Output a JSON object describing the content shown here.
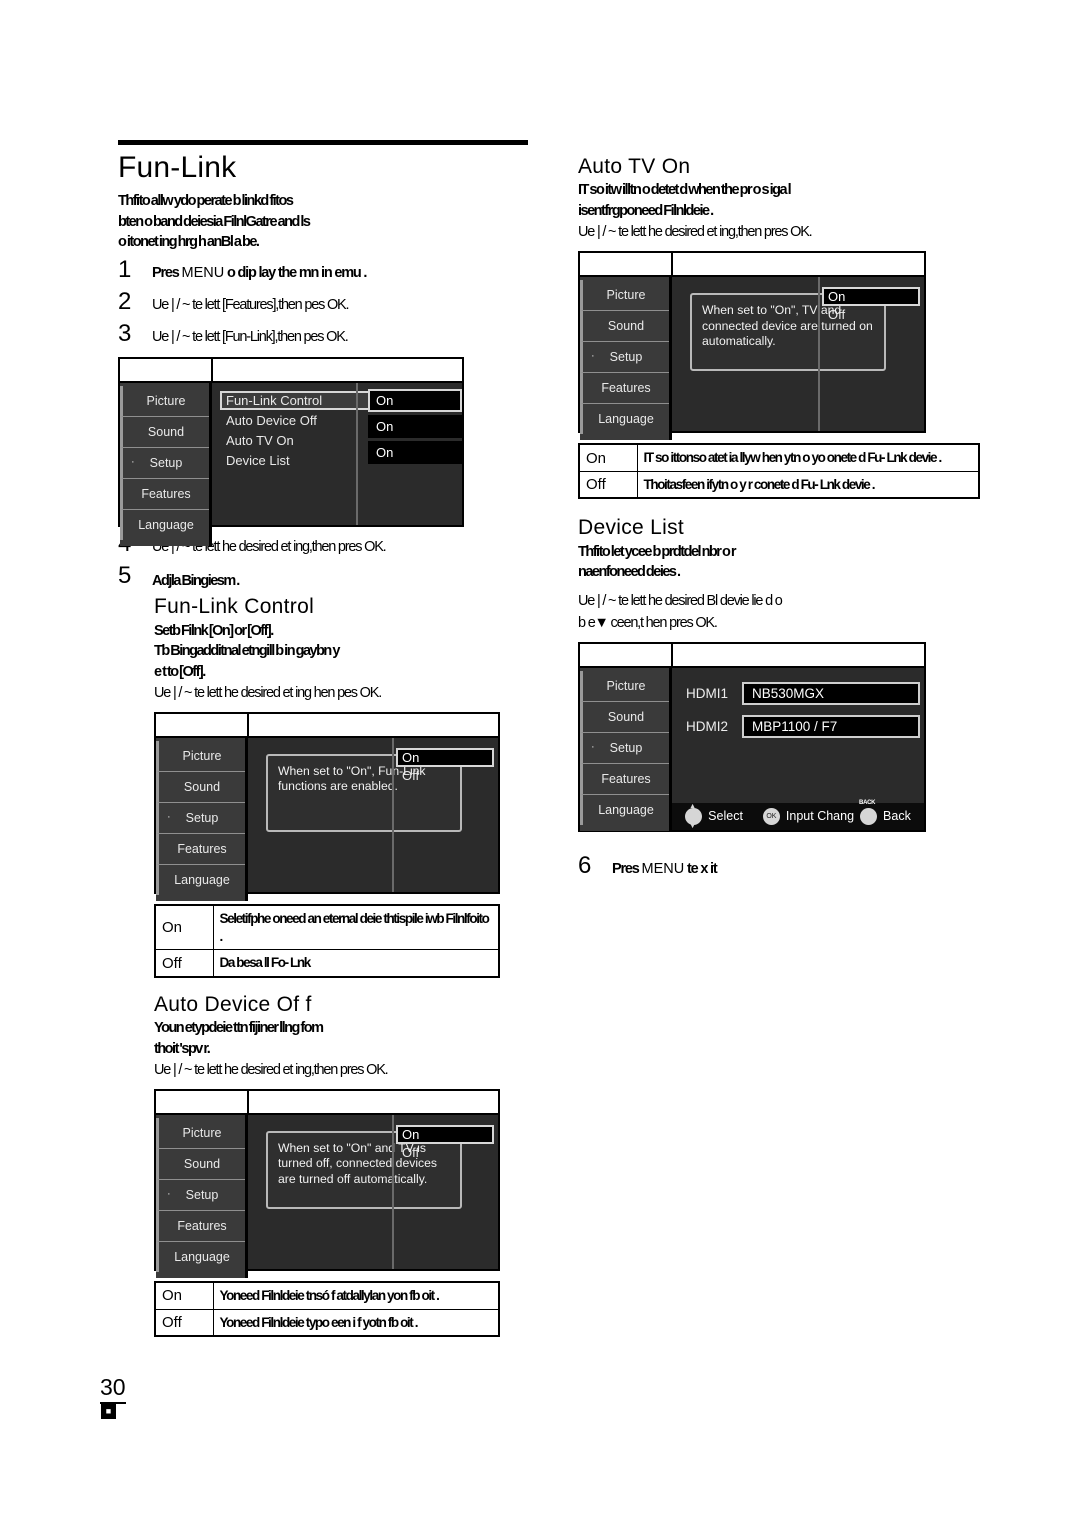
{
  "page": {
    "number": "30",
    "footer_icon": "en-lang-icon"
  },
  "left_column": {
    "title": "Fun-Link",
    "intro_lines": [
      "Thfito allw          ydo       perate b linkd fitos",
      "bten o band deiesia FilnlGatre and ls",
      "o itonet   ing hrg  h anBl       a be."
    ],
    "steps": [
      {
        "num": "1",
        "text_pre": "Pres ",
        "text_mid": "MENU",
        "text_post": " o dip lay the mn in emu ."
      },
      {
        "num": "2",
        "text": "Ue  | / ~  te   lett [Features],then pes  OK."
      },
      {
        "num": "3",
        "text": "Ue  | / ~  te   lett [Fun-Link],then pes  OK."
      },
      {
        "num": "4",
        "text": "Ue  | / ~  te   lett he desired et ing,then pres OK."
      },
      {
        "num": "5",
        "text": "Adjla Bingiesm                 ."
      }
    ],
    "menu_main": {
      "nav": [
        "Picture",
        "Sound",
        "Setup",
        "Features",
        "Language"
      ],
      "selected_nav": "Setup",
      "rows": [
        {
          "label": "Fun-Link Control",
          "value": "On",
          "selected": true
        },
        {
          "label": "Auto Device Off",
          "value": "On",
          "selected": false
        },
        {
          "label": "Auto TV On",
          "value": "On",
          "selected": false
        },
        {
          "label": "Device List",
          "value": "",
          "selected": false
        }
      ]
    },
    "fun_link_control": {
      "heading": "Fun-Link Control",
      "lines": [
        "Setb Filnk          [On] or [Off].",
        "Tb Bingadditnal etngill b in gaybn y",
        "e t to [Off].",
        "Ue  | / ~  te   lett he desired et ing hen pes  OK."
      ],
      "menu": {
        "nav": [
          "Picture",
          "Sound",
          "Setup",
          "Features",
          "Language"
        ],
        "selected_nav": "Setup",
        "help_text": "When set to \"On\", Fun-Link functions are enabled.",
        "options": [
          "On",
          "Off"
        ],
        "selected_option": "On"
      },
      "table": [
        {
          "key": "On",
          "value": "Seletifphe oneed an eternal deie\nthtispile iwb Filnlfoito                      ."
        },
        {
          "key": "Off",
          "value": "Da besa ll Fo- Lnk"
        }
      ]
    },
    "auto_device_off": {
      "heading": "Auto Device Of f",
      "lines": [
        "Youn etypdeie ttn fijiner llng fom",
        "thoit 'spv      r.",
        "Ue  | / ~  te   lett he desired et ing,then pres OK."
      ],
      "menu": {
        "nav": [
          "Picture",
          "Sound",
          "Setup",
          "Features",
          "Language"
        ],
        "selected_nav": "Setup",
        "help_text": "When set to \"On\" and TV is turned off, connected devices are turned off automatically.",
        "options": [
          "On",
          "Off"
        ],
        "selected_option": "On"
      },
      "table": [
        {
          "key": "On",
          "value": "Yoneed Filnldeie tnsó                    f\n atdallylan yon fb oit                        ."
        },
        {
          "key": "Off",
          "value": "Yoneed           Filnldeie      typo een i     f\n yotn fb oit            ."
        }
      ]
    }
  },
  "right_column": {
    "auto_tv_on": {
      "heading": "Auto TV On",
      "lines": [
        "IT so itw illtn o  detet d when the pr o s      iga l",
        "isentfrgponeed Filnldeie                                    .",
        "Ue  | / ~  te   lett he desired et ing,then pres OK."
      ],
      "menu": {
        "nav": [
          "Picture",
          "Sound",
          "Setup",
          "Features",
          "Language"
        ],
        "selected_nav": "Setup",
        "help_text": "When set to \"On\", TV and connected device are turned on automatically.",
        "options": [
          "On",
          "Off"
        ],
        "selected_option": "On"
      },
      "table": [
        {
          "key": "On",
          "value": "IT so ittonso atet            ia llyw hen ytn o\n yo onete     d Fu- Lnk devie ."
        },
        {
          "key": "Off",
          "value": "Thoitasfeen ifytn o y                          r\n conete   d Fu- Lnk devie ."
        }
      ]
    },
    "device_list": {
      "heading": "Device List",
      "lines": [
        "Thfito let          ycee b       prdtdel nbr o               r",
        "naenfoneed deies              .",
        "Ue  | / ~  te   lett he desired Bl     devie lie d o",
        "b e▼  ceen,t hen pres OK."
      ],
      "menu": {
        "nav": [
          "Picture",
          "Sound",
          "Setup",
          "Features",
          "Language"
        ],
        "selected_nav": "Setup",
        "devices": [
          {
            "label": "HDMI1",
            "name": "NB530MGX"
          },
          {
            "label": "HDMI2",
            "name": "MBP1100 / F7"
          }
        ],
        "help_bar": [
          {
            "icon": "dpad-updown-icon",
            "key": "",
            "label": "Select"
          },
          {
            "icon": "ok-button-icon",
            "key": "OK",
            "label": "Input Chang"
          },
          {
            "icon": "back-button-icon",
            "key": "BACK",
            "label": "Back"
          }
        ]
      }
    },
    "final_step": {
      "num": "6",
      "text_pre": "Pres ",
      "text_mid": "MENU",
      "text_post": " te x it"
    }
  },
  "colors": {
    "osd_bg": "#2b2b2b",
    "osd_nav_bg": "#3a3a3a",
    "osd_value_bg": "#000000",
    "osd_text": "#e9e9e9"
  }
}
